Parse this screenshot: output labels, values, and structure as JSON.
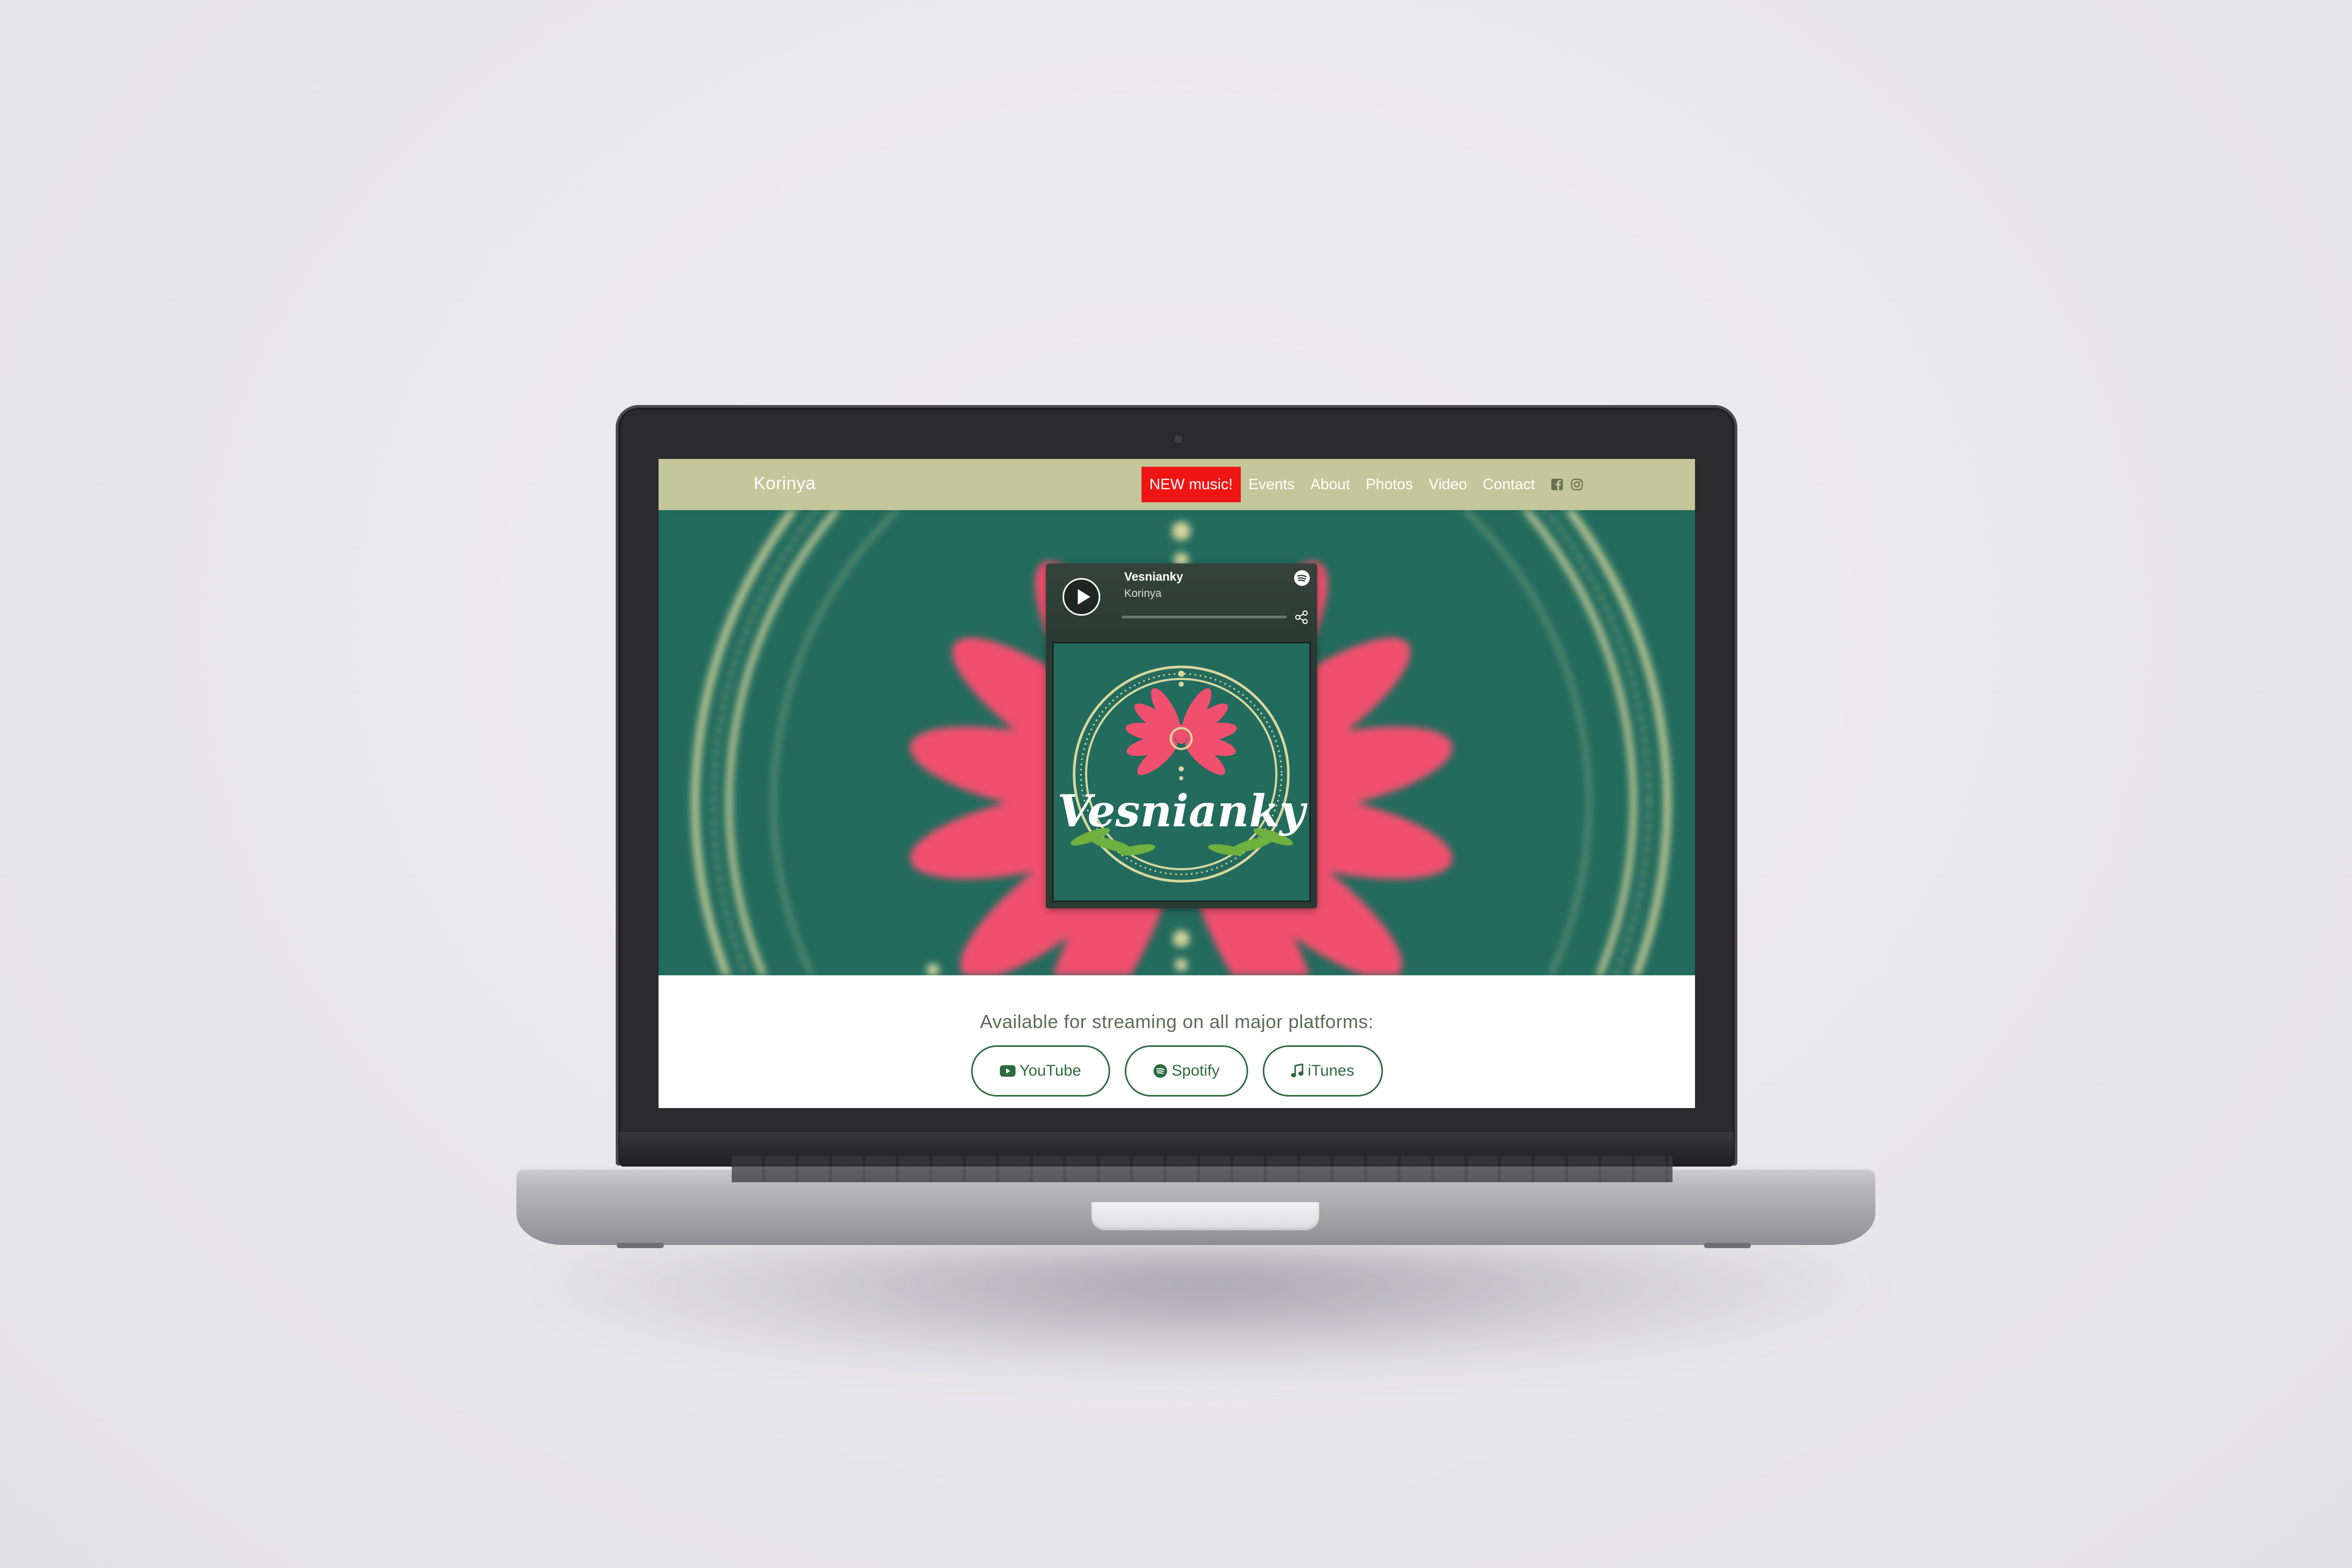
{
  "navbar": {
    "brand": "Korinya",
    "new_music_label": "NEW music!",
    "links": [
      "Events",
      "About",
      "Photos",
      "Video",
      "Contact"
    ],
    "social_icons": [
      "facebook-icon",
      "instagram-icon"
    ],
    "colors": {
      "background": "#c3c79b",
      "highlight": "#f01515"
    }
  },
  "hero": {
    "colors": {
      "background": "#236b5d",
      "flower": "#f0506e",
      "ring": "#d7d79f"
    }
  },
  "player": {
    "track_title": "Vesnianky",
    "artist": "Korinya",
    "progress": 0,
    "cover_text": "Vesnianky",
    "icons": [
      "play-icon",
      "spotify-icon",
      "share-icon"
    ]
  },
  "streaming": {
    "heading": "Available for streaming on all major platforms:",
    "buttons": [
      {
        "label": "YouTube",
        "icon": "youtube-icon"
      },
      {
        "label": "Spotify",
        "icon": "spotify-icon"
      },
      {
        "label": "iTunes",
        "icon": "music-note-icon"
      }
    ],
    "colors": {
      "button": "#2d6b3e"
    }
  }
}
